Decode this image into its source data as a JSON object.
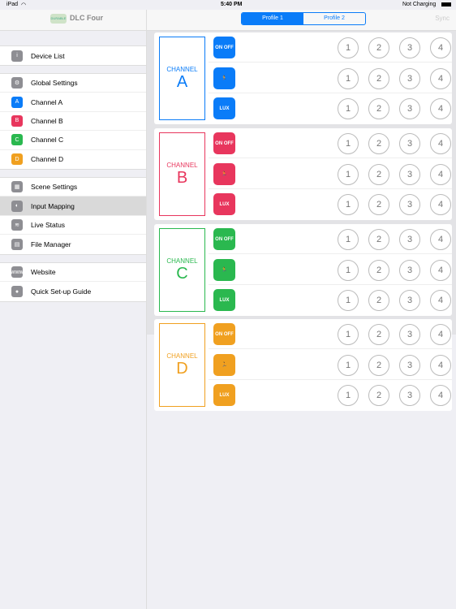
{
  "status": {
    "device": "iPad",
    "time": "5:40 PM",
    "battery": "Not Charging"
  },
  "nav": {
    "title": "DLC Four",
    "logo_text": "DURABLE",
    "profiles": [
      "Profile 1",
      "Profile 2"
    ],
    "selected_profile": 0,
    "sync": "Sync"
  },
  "sidebar": {
    "groups": [
      [
        {
          "label": "Device List",
          "icon": "info-icon",
          "glyph": "i"
        }
      ],
      [
        {
          "label": "Global Settings",
          "icon": "gear-icon",
          "glyph": "⚙"
        },
        {
          "label": "Channel A",
          "icon": "A",
          "glyph": "A",
          "color": "#0a7cf8"
        },
        {
          "label": "Channel B",
          "icon": "B",
          "glyph": "B",
          "color": "#e8365d"
        },
        {
          "label": "Channel C",
          "icon": "C",
          "glyph": "C",
          "color": "#2ab84f"
        },
        {
          "label": "Channel D",
          "icon": "D",
          "glyph": "D",
          "color": "#f0a020"
        }
      ],
      [
        {
          "label": "Scene Settings",
          "icon": "grid-icon",
          "glyph": "▦"
        },
        {
          "label": "Input Mapping",
          "icon": "toggle-icon",
          "glyph": "◐",
          "selected": true
        },
        {
          "label": "Live Status",
          "icon": "wifi-icon",
          "glyph": "≋"
        },
        {
          "label": "File Manager",
          "icon": "file-icon",
          "glyph": "▤"
        }
      ],
      [
        {
          "label": "Website",
          "icon": "www-icon",
          "glyph": "www"
        },
        {
          "label": "Quick Set-up Guide",
          "icon": "person-icon",
          "glyph": "●"
        }
      ]
    ]
  },
  "channels": [
    {
      "label": "CHANNEL",
      "letter": "A",
      "color": "#0a7cf8"
    },
    {
      "label": "CHANNEL",
      "letter": "B",
      "color": "#e8365d"
    },
    {
      "label": "CHANNEL",
      "letter": "C",
      "color": "#2ab84f"
    },
    {
      "label": "CHANNEL",
      "letter": "D",
      "color": "#f0a020"
    }
  ],
  "rows": [
    {
      "type": "switch",
      "text": "ON OFF"
    },
    {
      "type": "occupancy",
      "text": "🏃"
    },
    {
      "type": "lux",
      "text": "LUX"
    }
  ],
  "inputs": [
    "1",
    "2",
    "3",
    "4"
  ]
}
